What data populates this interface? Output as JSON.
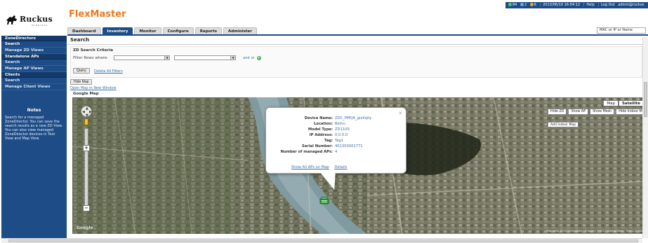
{
  "header": {
    "logo_text": "Ruckus",
    "logo_sub": "WIRELESS",
    "app_title": "FlexMaster",
    "status": {
      "count_green": "84",
      "count_blue": "2",
      "count_orange": "6",
      "timestamp": "2013/06/10 16:04:12",
      "help": "Help",
      "logout": "Log Out",
      "user": "admin@ruckus"
    },
    "quick_search_value": "MAC or IP or Name"
  },
  "tabs": [
    {
      "label": "Dashboard"
    },
    {
      "label": "Inventory"
    },
    {
      "label": "Monitor"
    },
    {
      "label": "Configure"
    },
    {
      "label": "Reports"
    },
    {
      "label": "Administer"
    }
  ],
  "sidebar": {
    "sections": [
      {
        "title": "ZoneDirectors",
        "items": [
          "Search",
          "Manage ZD Views"
        ]
      },
      {
        "title": "Standalone APs",
        "items": [
          "Search",
          "Manage AP Views"
        ]
      },
      {
        "title": "Clients",
        "items": [
          "Search",
          "Manage Client Views"
        ]
      }
    ],
    "notes_title": "Notes",
    "notes_text": "Search for a managed ZoneDirector. You can save the search results as a new ZD View. You can also view managed ZoneDirector devices in Text View and Map View."
  },
  "main": {
    "page_title": "Search",
    "criteria_title": "ZD Search Criteria",
    "filter_label": "Filter Rows where:",
    "and_label": "and",
    "or_label": "or",
    "query_button": "Query",
    "delete_filters": "Delete All Filters",
    "hide_map": "Hide Map",
    "open_map": "Open Map In New Window",
    "google_map_label": "Google Map"
  },
  "map": {
    "map_type_map": "Map",
    "map_type_satellite": "Satellite",
    "actions": [
      "Hide ZD",
      "Show AP",
      "Show Mesh",
      "Hide Indoor Map"
    ],
    "add_indoor_map": "Add Indoor Map",
    "info": {
      "rows": [
        {
          "key": "Device Name:",
          "value": "ZDC_PMQA_guiliqity"
        },
        {
          "key": "Location:",
          "value": "Beihu"
        },
        {
          "key": "Model Type:",
          "value": "ZD1100"
        },
        {
          "key": "IP Address:",
          "value": "0.0.0.0"
        },
        {
          "key": "Tag:",
          "value": "Tag1"
        },
        {
          "key": "Serial Number:",
          "value": "401303001771"
        },
        {
          "key": "Number of managed APs:",
          "value": "4"
        }
      ],
      "link_show_aps": "Show All APs on Map",
      "link_details": "Details",
      "close": "x"
    },
    "attribution": "Map data ©2013 AutoNavi · Imagery ©2013 DigitalGlobe · Terms of Use",
    "google": "Google"
  },
  "colors": {
    "brand_orange": "#e87a1e",
    "nav_blue": "#1d4c86",
    "link_blue": "#3a6ea5"
  }
}
